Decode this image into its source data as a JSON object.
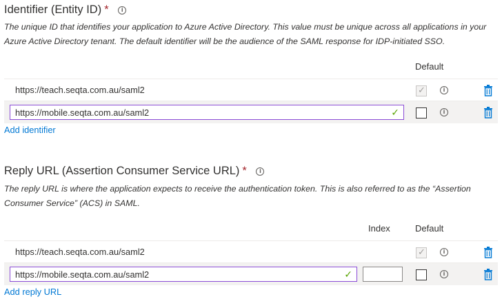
{
  "identifier": {
    "title": "Identifier (Entity ID)",
    "required_mark": "*",
    "info_icon": "info-icon",
    "description": "The unique ID that identifies your application to Azure Active Directory. This value must be unique across all applications in your Azure Active Directory tenant. The default identifier will be the audience of the SAML response for IDP-initiated SSO.",
    "default_header": "Default",
    "rows": [
      {
        "value": "https://teach.seqta.com.au/saml2",
        "editable": false,
        "default_checked": true,
        "default_disabled": true
      },
      {
        "value": "https://mobile.seqta.com.au/saml2",
        "editable": true,
        "valid": true,
        "default_checked": false,
        "default_disabled": false
      }
    ],
    "add_link": "Add identifier"
  },
  "reply_url": {
    "title": "Reply URL (Assertion Consumer Service URL)",
    "required_mark": "*",
    "info_icon": "info-icon",
    "description": "The reply URL is where the application expects to receive the authentication token. This is also referred to as the “Assertion Consumer Service” (ACS) in SAML.",
    "index_header": "Index",
    "default_header": "Default",
    "rows": [
      {
        "value": "https://teach.seqta.com.au/saml2",
        "editable": false,
        "index": "",
        "default_checked": true,
        "default_disabled": true
      },
      {
        "value": "https://mobile.seqta.com.au/saml2",
        "editable": true,
        "valid": true,
        "index": "",
        "default_checked": false,
        "default_disabled": false
      }
    ],
    "add_link": "Add reply URL"
  },
  "icons": {
    "info": "info-icon",
    "delete": "trash-icon",
    "valid": "checkmark-icon"
  },
  "colors": {
    "accent_link": "#0078d4",
    "input_focus_border": "#8a4bd6",
    "required": "#a4262c",
    "delete_icon": "#0078d4",
    "valid_check": "#57a300"
  }
}
